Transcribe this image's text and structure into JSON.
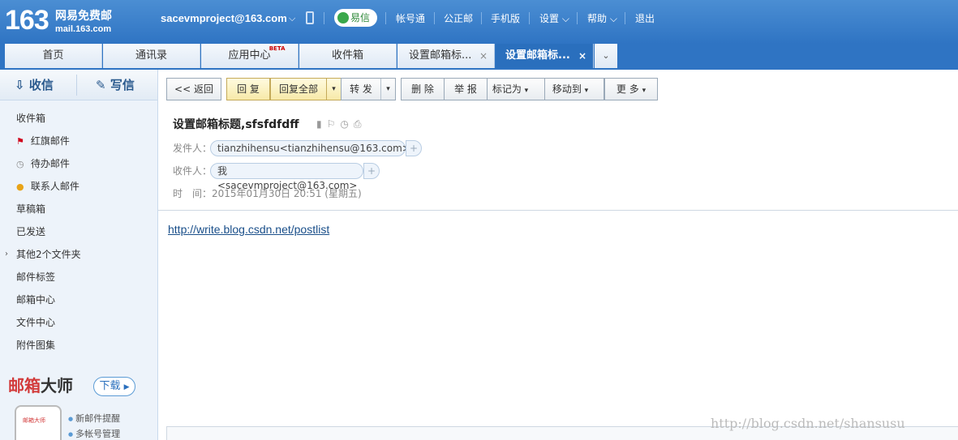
{
  "header": {
    "logo_number": "163",
    "logo_name": "网易免费邮",
    "logo_url": "mail.163.com",
    "account": "sacevmproject@163.com",
    "account_caret": "⌵",
    "yixin": "易信",
    "links": [
      "帐号通",
      "公正邮",
      "手机版",
      "设置",
      "帮助",
      "退出"
    ]
  },
  "tabs": [
    {
      "label": "首页",
      "close": ""
    },
    {
      "label": "通讯录",
      "close": ""
    },
    {
      "label": "应用中心",
      "badge": "BETA",
      "close": ""
    },
    {
      "label": "收件箱",
      "close": ""
    },
    {
      "label": "设置邮箱标...",
      "close": "×"
    },
    {
      "label": "设置邮箱标...",
      "close": "×"
    }
  ],
  "tab_dropdown": "⌄",
  "sidebar": {
    "receive": "收信",
    "write": "写信",
    "folders": [
      "收件箱",
      "红旗邮件",
      "待办邮件",
      "联系人邮件",
      "草稿箱",
      "已发送",
      "其他2个文件夹",
      "邮件标签",
      "邮箱中心",
      "文件中心",
      "附件图集"
    ],
    "promo": {
      "title_red": "邮箱",
      "title_dark": "大师",
      "download": "下载",
      "phone_logo": "邮箱大师",
      "items": [
        "新邮件提醒",
        "多帐号管理"
      ]
    }
  },
  "toolbar": {
    "back": "<< 返回",
    "reply": "回 复",
    "reply_all": "回复全部",
    "forward": "转 发",
    "delete": "删 除",
    "report": "举 报",
    "mark": "标记为",
    "move": "移动到",
    "more": "更 多",
    "dd": "▾"
  },
  "mail": {
    "subject": "设置邮箱标题,sfsfdfdff",
    "from_label": "发件人：",
    "from_value": "tianzhihensu<tianzhihensu@163.com>",
    "to_label": "收件人：",
    "to_value": "我<sacevmproject@163.com>",
    "plus": "+",
    "time_label": "时　间：",
    "time_value": "2015年01月30日 20:51 (星期五)",
    "body_link": "http://write.blog.csdn.net/postlist"
  },
  "watermark": "http://blog.csdn.net/shansusu",
  "colors": {
    "header_blue": "#2f74c3",
    "accent": "#2a6fbd",
    "reply_yellow": "#f7e9a8",
    "flag_red": "#d0021b"
  }
}
